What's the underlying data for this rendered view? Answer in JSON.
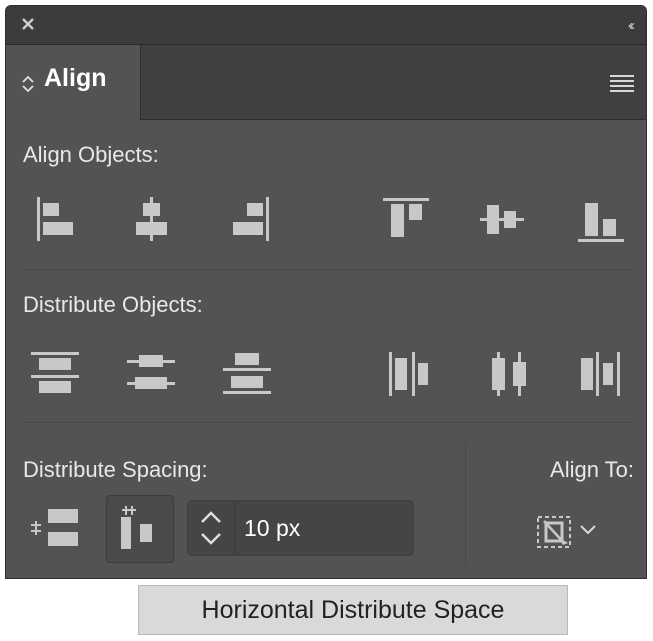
{
  "window": {
    "close_icon": "close-icon",
    "collapse_icon": "collapse-double-chevron-icon",
    "collapse_glyph": "‹‹"
  },
  "tab": {
    "label": "Align",
    "icon": "up-down-chevron-icon"
  },
  "panel_menu_icon": "hamburger-menu-icon",
  "align_objects": {
    "title": "Align Objects:",
    "buttons": [
      "horizontal-align-left-icon",
      "horizontal-align-center-icon",
      "horizontal-align-right-icon",
      "vertical-align-top-icon",
      "vertical-align-center-icon",
      "vertical-align-bottom-icon"
    ]
  },
  "distribute_objects": {
    "title": "Distribute Objects:",
    "buttons": [
      "vertical-distribute-top-icon",
      "vertical-distribute-center-icon",
      "vertical-distribute-bottom-icon",
      "horizontal-distribute-left-icon",
      "horizontal-distribute-center-icon",
      "horizontal-distribute-right-icon"
    ]
  },
  "distribute_spacing": {
    "title": "Distribute Spacing:",
    "buttons": [
      "vertical-distribute-space-icon",
      "horizontal-distribute-space-icon"
    ],
    "active_button": "horizontal-distribute-space-icon",
    "spacing_value": "10 px"
  },
  "align_to": {
    "title": "Align To:",
    "icon": "align-to-key-object-icon",
    "dropdown_icon": "chevron-down-icon"
  },
  "tooltip": "Horizontal Distribute Space",
  "colors": {
    "panel_bg": "#535353",
    "titlebar_bg": "#3c3c3c",
    "icon_fill": "#c8c8c8",
    "tooltip_bg": "#d9d9d9"
  }
}
